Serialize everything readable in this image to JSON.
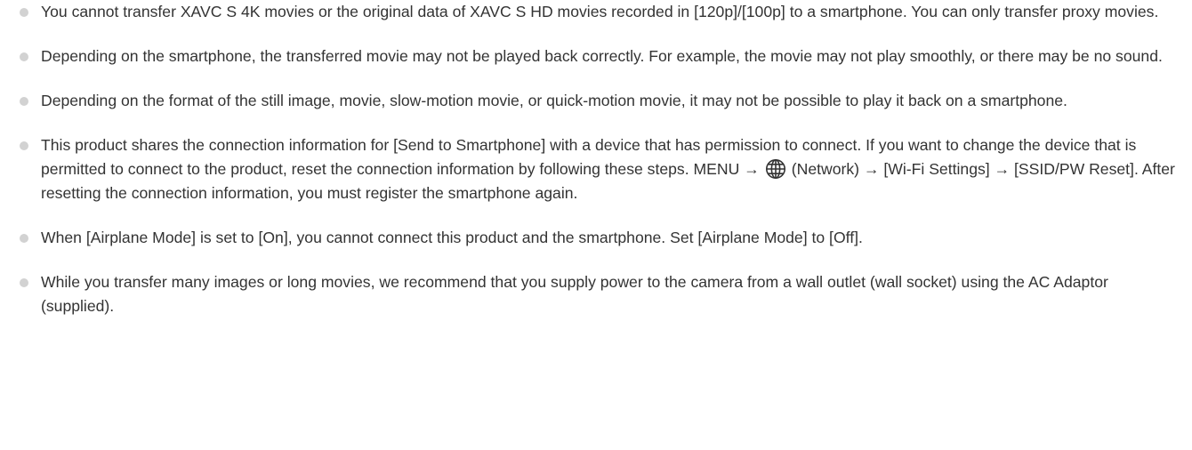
{
  "notes": [
    "You cannot transfer XAVC S 4K movies or the original data of XAVC S HD movies recorded in [120p]/[100p] to a smartphone. You can only transfer proxy movies.",
    "Depending on the smartphone, the transferred movie may not be played back correctly. For example, the movie may not play smoothly, or there may be no sound.",
    "Depending on the format of the still image, movie, slow-motion movie, or quick-motion movie, it may not be possible to play it back on a smartphone.",
    {
      "before_icon": "This product shares the connection information for [Send to Smartphone] with a device that has permission to connect. If you want to change the device that is permitted to connect to the product, reset the connection information by following these steps. MENU →",
      "icon": "globe-network-icon",
      "after_icon": "(Network) → [Wi-Fi Settings] → [SSID/PW Reset]. After resetting the connection information, you must register the smartphone again."
    },
    "When [Airplane Mode] is set to [On], you cannot connect this product and the smartphone. Set [Airplane Mode] to [Off].",
    "While you transfer many images or long movies, we recommend that you supply power to the camera from a wall outlet (wall socket) using the AC Adaptor (supplied)."
  ],
  "colors": {
    "text": "#333333",
    "bullet": "#d2d2d2",
    "background": "#ffffff"
  }
}
